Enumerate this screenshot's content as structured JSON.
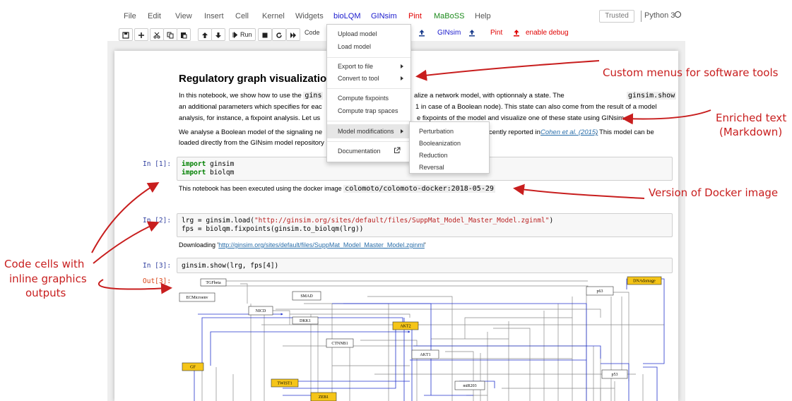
{
  "menubar": {
    "items": [
      {
        "label": "File",
        "style": ""
      },
      {
        "label": "Edit",
        "style": ""
      },
      {
        "label": "View",
        "style": ""
      },
      {
        "label": "Insert",
        "style": ""
      },
      {
        "label": "Cell",
        "style": ""
      },
      {
        "label": "Kernel",
        "style": ""
      },
      {
        "label": "Widgets",
        "style": ""
      },
      {
        "label": "bioLQM",
        "style": "blue"
      },
      {
        "label": "GINsim",
        "style": "blue"
      },
      {
        "label": "Pint",
        "style": "red"
      },
      {
        "label": "MaBoSS",
        "style": "green"
      },
      {
        "label": "Help",
        "style": ""
      }
    ],
    "trusted_label": "Trusted",
    "kernel_name": "Python 3"
  },
  "toolbar": {
    "run_label": "Run",
    "cell_type": "Code",
    "ginsim_label": "GINsim",
    "pint_label": "Pint",
    "debug_label": "enable debug"
  },
  "dropdown": {
    "items": [
      "Upload model",
      "Load model",
      "Export to file",
      "Convert to tool",
      "Compute fixpoints",
      "Compute trap spaces",
      "Model modifications",
      "Documentation"
    ],
    "submenu": [
      "Perturbation",
      "Booleanization",
      "Reduction",
      "Reversal"
    ]
  },
  "notebook": {
    "title": "Regulatory graph visualizatio",
    "p1_l1_a": "In this notebook, we show how to use the",
    "p1_l1_code": "gins",
    "p1_l1_b": "alize a network model, with optionnaly a state. The",
    "p1_l1_code2": "ginsim.show",
    "p1_l2_a": "an additional parameters which specifies for eac",
    "p1_l2_b": "1 in case of a Boolean node). This state can also come from the result of a model",
    "p1_l3_a": "analysis, for instance, a fixpoint analysis. Let us",
    "p1_l3_b": "e fixpoints of the model and visualize one of these state using GINsim.",
    "p2_l1_a": "We analyse a Boolean model of the signaling ne",
    "p2_l1_b": "cently reported in",
    "p2_l1_link": "Cohen et al. (2015)",
    "p2_l1_c": ". This model can be",
    "p2_l2": "loaded directly from the GINsim model repository",
    "cells": [
      {
        "prompt": "In [1]:",
        "lines": [
          {
            "kw": "import",
            "rest": " ginsim"
          },
          {
            "kw": "import",
            "rest": " biolqm"
          }
        ]
      },
      {
        "prompt": "In [2]:",
        "line1_a": "lrg = ginsim.load(",
        "line1_str": "\"http://ginsim.org/sites/default/files/SuppMat_Model_Master_Model.zginml\"",
        "line1_b": ")",
        "line2": "fps = biolqm.fixpoints(ginsim.to_biolqm(lrg))"
      },
      {
        "prompt": "In [3]:",
        "line": "ginsim.show(lrg, fps[4])"
      }
    ],
    "output1_text": "This notebook has been executed using the docker image",
    "output1_code": "colomoto/colomoto-docker:2018-05-29",
    "output2_a": "Downloading '",
    "output2_link": "http://ginsim.org/sites/default/files/SuppMat_Model_Master_Model.zginml",
    "output2_b": "'",
    "out3_prompt": "Out[3]:"
  },
  "graph": {
    "nodes": [
      {
        "id": "TGFbeta",
        "active": false
      },
      {
        "id": "ECMicroenv",
        "active": false
      },
      {
        "id": "SMAD",
        "active": false
      },
      {
        "id": "NICD",
        "active": false
      },
      {
        "id": "DKK1",
        "active": false
      },
      {
        "id": "AKT2",
        "active": true
      },
      {
        "id": "CTNNB1",
        "active": false
      },
      {
        "id": "AKT1",
        "active": false
      },
      {
        "id": "GF",
        "active": true
      },
      {
        "id": "TWIST1",
        "active": true
      },
      {
        "id": "ZEB1",
        "active": true
      },
      {
        "id": "miR203",
        "active": false
      },
      {
        "id": "p63",
        "active": false
      },
      {
        "id": "DNAdamage",
        "active": true
      },
      {
        "id": "p53",
        "active": false
      }
    ],
    "active_color": "#f5c518"
  },
  "annotations": {
    "menus": "Custom menus for software tools",
    "enriched_1": "Enriched text",
    "enriched_2": "(Markdown)",
    "docker": "Version of Docker image",
    "cells_1": "Code cells with",
    "cells_2": "inline graphics",
    "cells_3": "outputs",
    "color": "#c81e1e"
  }
}
